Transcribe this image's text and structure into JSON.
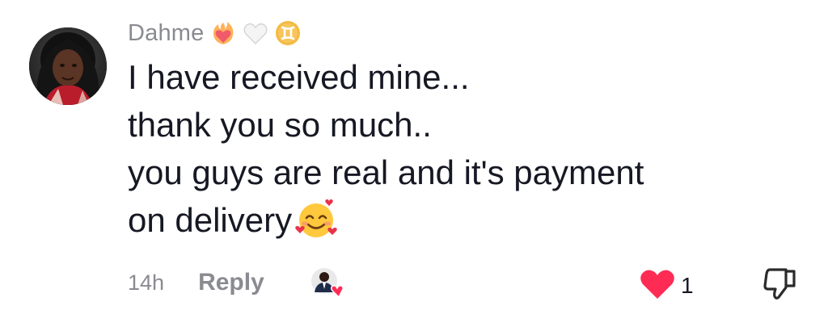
{
  "comment": {
    "username": "Dahme",
    "badges": [
      "heart-on-fire-icon",
      "white-heart-icon",
      "gemini-zodiac-icon"
    ],
    "lines": [
      "I have received mine...",
      "thank you so much..",
      "you guys are real and it's payment",
      "on delivery"
    ],
    "trailing_emoji": "smiling-face-with-hearts-icon",
    "time": "14h",
    "reply_label": "Reply",
    "creator_liked": true,
    "like_count": "1",
    "liked": true,
    "colors": {
      "username": "#8a8b91",
      "text": "#161823",
      "meta": "#8a8b91",
      "like_heart": "#fe2c55"
    }
  }
}
